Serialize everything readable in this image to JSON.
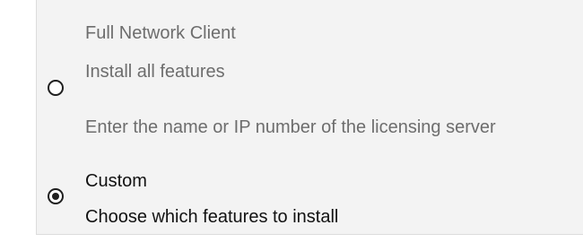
{
  "options": [
    {
      "title": "Full Network Client",
      "subtitle": "Install all features",
      "note": "Enter the name or IP number of the licensing server",
      "selected": false
    },
    {
      "title": "Custom",
      "subtitle": "Choose which features to install",
      "selected": true
    }
  ]
}
